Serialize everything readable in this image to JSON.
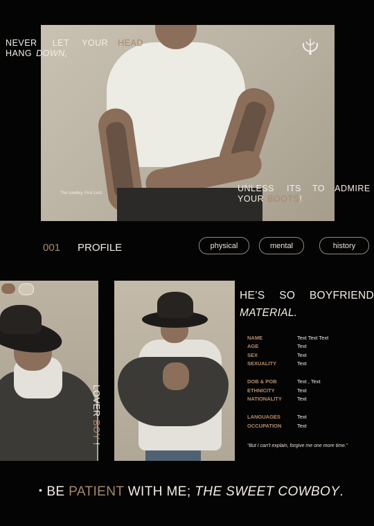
{
  "hero": {
    "quote_top": {
      "w1": "NEVER",
      "w2": "LET",
      "w3": "YOUR",
      "w4": "HEAD",
      "w5": "HANG",
      "w6": "DOWN,"
    },
    "caption": "The cowboy, First Lost.",
    "quote_bottom": {
      "w1": "UNLESS",
      "w2": "ITS",
      "w3": "TO",
      "w4": "ADMIRE",
      "w5": "YOUR",
      "w6": "BOOTS",
      "w7": "!"
    },
    "emblem_icon": "horseshoe-emblem-icon"
  },
  "profile": {
    "number": "001",
    "title": "PROFILE",
    "tabs": [
      "physical",
      "mental",
      "history"
    ]
  },
  "side_text": {
    "a": "LOVER",
    "b": "BOY",
    "c": "!"
  },
  "headline": {
    "l1a": "HE’S",
    "l1b": "SO",
    "l1c": "BOYFRIEND",
    "l2": "MATERIAL."
  },
  "fields": [
    {
      "label": "NAME",
      "value": "Text Text Text"
    },
    {
      "label": "AGE",
      "value": "Text"
    },
    {
      "label": "SEX",
      "value": "Text"
    },
    {
      "label": "SEXUALITY",
      "value": "Text"
    },
    {
      "label": "DOB & POB",
      "value": "Text , Text"
    },
    {
      "label": "ETHNICITY",
      "value": "Text"
    },
    {
      "label": "NATIONALITY",
      "value": "Text"
    },
    {
      "label": "LANGUAGES",
      "value": "Text"
    },
    {
      "label": "OCCUPATION",
      "value": "Text"
    }
  ],
  "small_quote": "“But I can’t explain, forgive me one more time.”",
  "bottom": {
    "bullet": "•",
    "p1": "BE",
    "p2": "PATIENT",
    "p3": "WITH ME;",
    "p4": "THE SWEET COWBOY",
    "p5": "."
  },
  "colors": {
    "background": "#050404",
    "accent": "#a6896a",
    "label": "#b58d6e",
    "text": "#f2ede6"
  }
}
